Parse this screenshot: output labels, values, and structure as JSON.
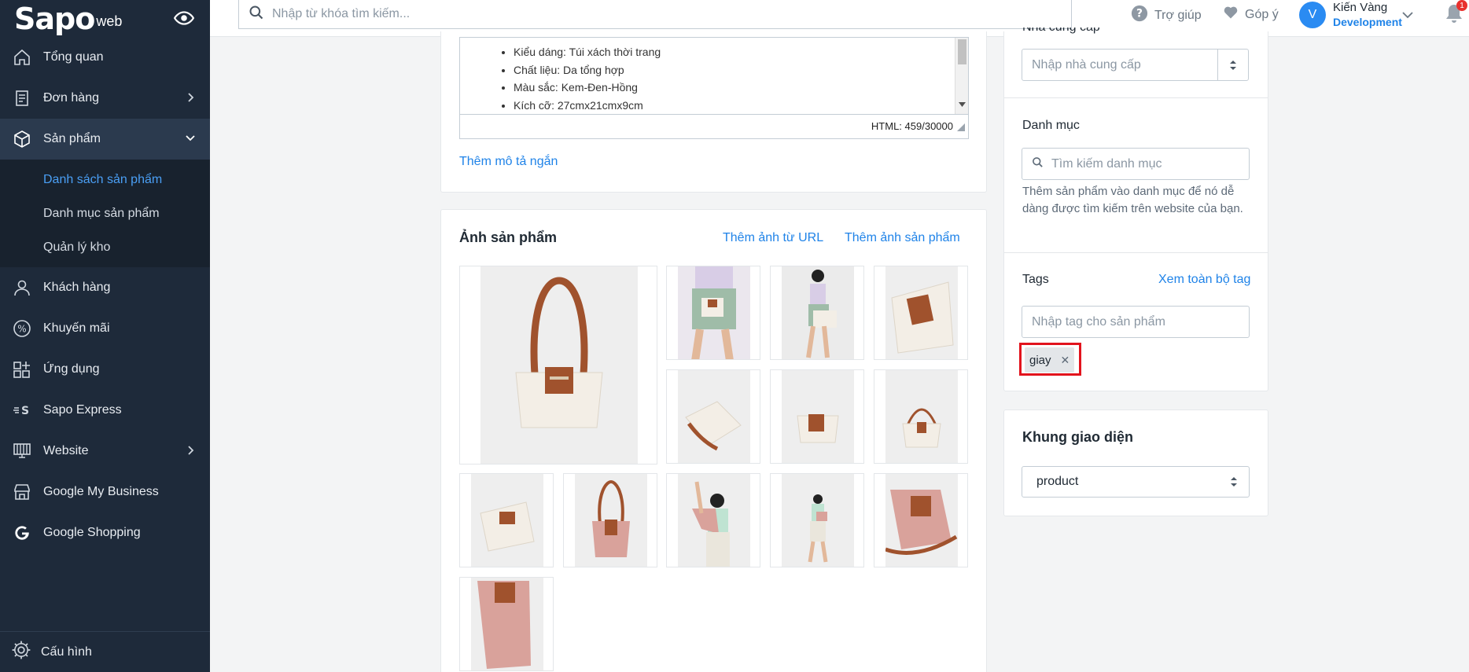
{
  "sidebar": {
    "logo_text": "Sapo",
    "logo_suffix": "web",
    "items": [
      {
        "label": "Tổng quan"
      },
      {
        "label": "Đơn hàng"
      },
      {
        "label": "Sản phẩm"
      },
      {
        "label": "Khách hàng"
      },
      {
        "label": "Khuyến mãi"
      },
      {
        "label": "Ứng dụng"
      },
      {
        "label": "Sapo Express"
      },
      {
        "label": "Website"
      },
      {
        "label": "Google My Business"
      },
      {
        "label": "Google Shopping"
      }
    ],
    "subitems": [
      {
        "label": "Danh sách sản phẩm"
      },
      {
        "label": "Danh mục sản phẩm"
      },
      {
        "label": "Quản lý kho"
      }
    ],
    "settings_label": "Cấu hình"
  },
  "header": {
    "search_placeholder": "Nhập từ khóa tìm kiếm...",
    "help_label": "Trợ giúp",
    "feedback_label": "Góp ý",
    "avatar_letter": "V",
    "user_name": "Kiến Vàng",
    "store_name": "Development",
    "notification_count": "1"
  },
  "description": {
    "bullets": [
      "Kiểu dáng: Túi xách thời trang",
      "Chất liệu: Da tổng hợp",
      "Màu sắc: Kem-Đen-Hồng",
      "Kích cỡ: 27cmx21cmx9cm"
    ],
    "html_counter": "HTML: 459/30000",
    "add_short_desc_link": "Thêm mô tả ngắn"
  },
  "images": {
    "title": "Ảnh sản phẩm",
    "add_from_url": "Thêm ảnh từ URL",
    "add_image": "Thêm ảnh sản phẩm"
  },
  "right_panel": {
    "supplier_label": "Nhà cung cấp",
    "supplier_placeholder": "Nhập nhà cung cấp",
    "category_label": "Danh mục",
    "category_placeholder": "Tìm kiếm danh mục",
    "category_help": "Thêm sản phẩm vào danh mục để nó dễ dàng được tìm kiếm trên website của bạn.",
    "tags_label": "Tags",
    "tags_view_all": "Xem toàn bộ tag",
    "tags_placeholder": "Nhập tag cho sản phẩm",
    "tags": [
      {
        "label": "giay"
      }
    ],
    "template_title": "Khung giao diện",
    "template_value": "product"
  },
  "colors": {
    "sidebar_bg": "#1e2a3a",
    "accent": "#1f83e8",
    "highlight": "#e2131d"
  }
}
